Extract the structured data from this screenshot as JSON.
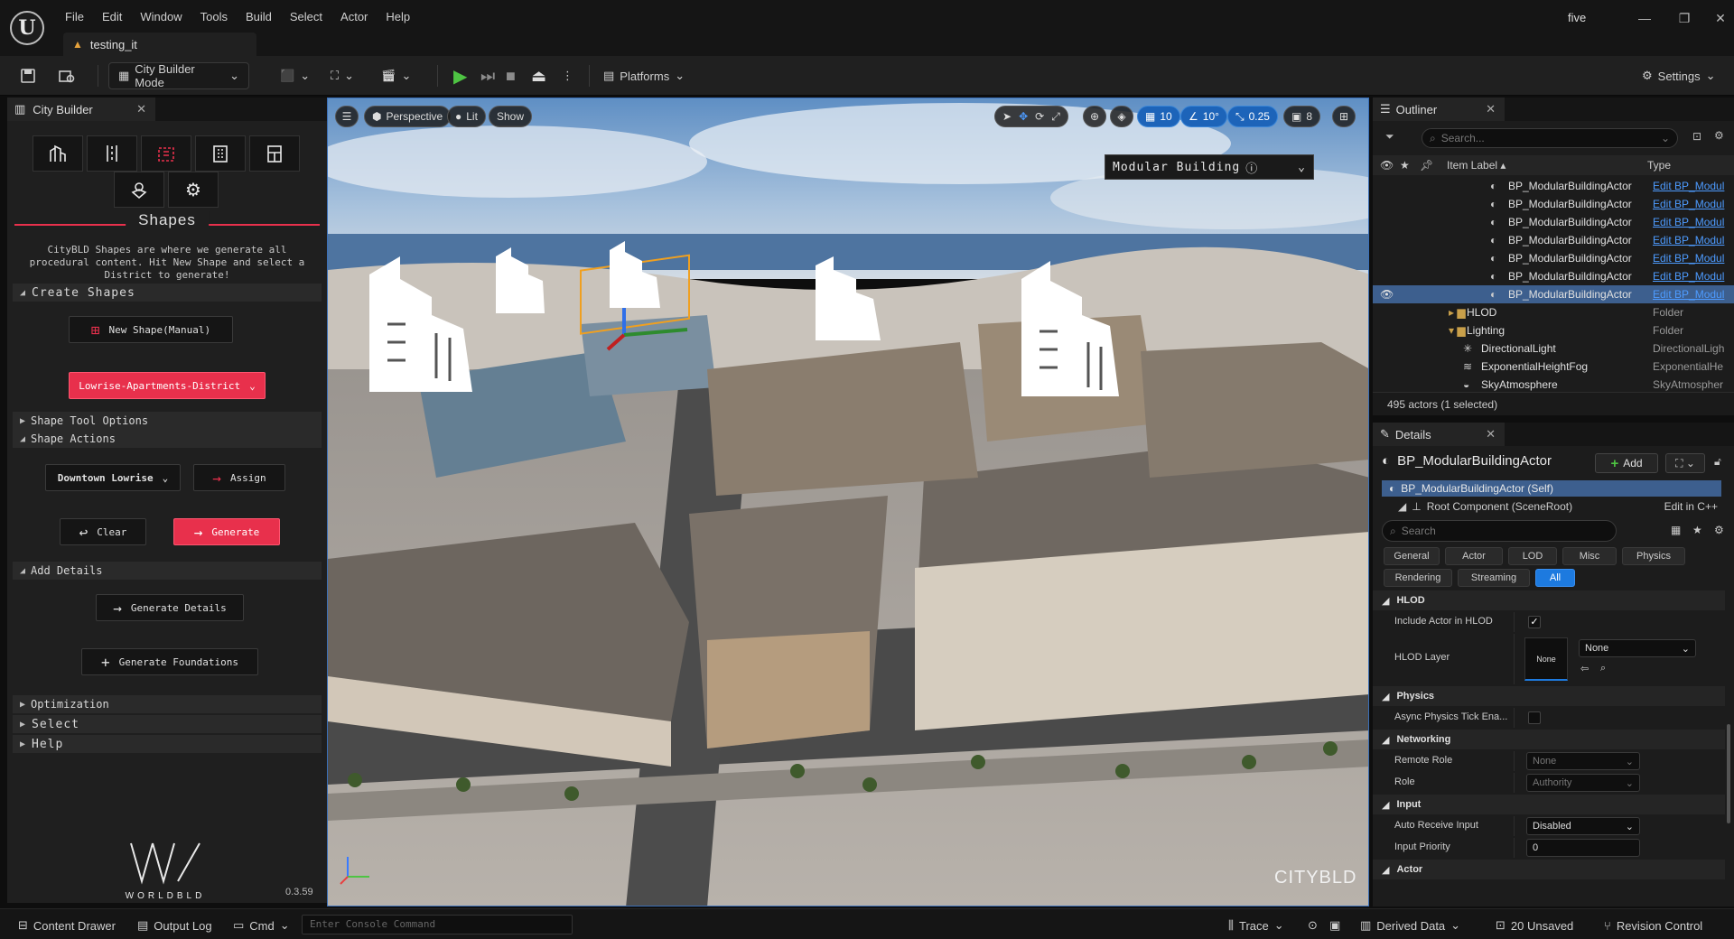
{
  "menu": [
    "File",
    "Edit",
    "Window",
    "Tools",
    "Build",
    "Select",
    "Actor",
    "Help"
  ],
  "project_tab": "testing_it",
  "user": "five",
  "toolbar": {
    "mode": "City Builder Mode",
    "platforms": "Platforms",
    "settings": "Settings"
  },
  "left_panel": {
    "tab": "City Builder",
    "icons": [
      "buildings-icon",
      "road-icon",
      "district-icon",
      "building-icon",
      "storefront-icon",
      "landmark-icon",
      "gear-icon"
    ],
    "shapes_title": "Shapes",
    "shapes_desc": "CityBLD Shapes are where we generate all procedural content. Hit New Shape and select a District to generate!",
    "create_shapes": "Create Shapes",
    "new_shape_button": "New Shape(Manual)",
    "district_dropdown": "Lowrise-Apartments-District",
    "shape_tool_options": "Shape Tool Options",
    "shape_actions": "Shape Actions",
    "downtown_dropdown": "Downtown Lowrise",
    "assign_button": "Assign",
    "clear_button": "Clear",
    "generate_button": "Generate",
    "add_details": "Add Details",
    "generate_details_button": "Generate Details",
    "generate_foundations_button": "Generate Foundations",
    "optimization": "Optimization",
    "select": "Select",
    "help": "Help",
    "brand": "WORLDBLD",
    "version": "0.3.59"
  },
  "viewport": {
    "perspective": "Perspective",
    "lit": "Lit",
    "show": "Show",
    "grid_snap": "10",
    "rot_snap": "10°",
    "scale_snap": "0.25",
    "cam_speed": "8",
    "dropdown": "Modular Building",
    "watermark": "CITYBLD"
  },
  "outliner": {
    "tab": "Outliner",
    "search_placeholder": "Search...",
    "col_label": "Item Label",
    "col_type": "Type",
    "rows": [
      {
        "label": "BP_ModularBuildingActor",
        "type": "Edit BP_Modul"
      },
      {
        "label": "BP_ModularBuildingActor",
        "type": "Edit BP_Modul"
      },
      {
        "label": "BP_ModularBuildingActor",
        "type": "Edit BP_Modul"
      },
      {
        "label": "BP_ModularBuildingActor",
        "type": "Edit BP_Modul"
      },
      {
        "label": "BP_ModularBuildingActor",
        "type": "Edit BP_Modul"
      },
      {
        "label": "BP_ModularBuildingActor",
        "type": "Edit BP_Modul"
      },
      {
        "label": "BP_ModularBuildingActor",
        "type": "Edit BP_Modul"
      },
      {
        "label": "HLOD",
        "type": "Folder"
      },
      {
        "label": "Lighting",
        "type": "Folder"
      },
      {
        "label": "DirectionalLight",
        "type": "DirectionalLigh"
      },
      {
        "label": "ExponentialHeightFog",
        "type": "ExponentialHe"
      },
      {
        "label": "SkyAtmosphere",
        "type": "SkyAtmospher"
      }
    ],
    "footer": "495 actors (1 selected)"
  },
  "details": {
    "tab": "Details",
    "title": "BP_ModularBuildingActor",
    "add": "Add",
    "self_row": "BP_ModularBuildingActor (Self)",
    "root_row": "Root Component (SceneRoot)",
    "root_edit": "Edit in C++",
    "search_placeholder": "Search",
    "filters": [
      "General",
      "Actor",
      "LOD",
      "Misc",
      "Physics",
      "Rendering",
      "Streaming",
      "All"
    ],
    "hlod": "HLOD",
    "include_hlod": "Include Actor in HLOD",
    "hlod_layer": "HLOD Layer",
    "hlod_thumb": "None",
    "hlod_combo": "None",
    "physics": "Physics",
    "async_physics": "Async Physics Tick Ena...",
    "networking": "Networking",
    "remote_role": "Remote Role",
    "remote_role_val": "None",
    "role": "Role",
    "role_val": "Authority",
    "input": "Input",
    "auto_receive": "Auto Receive Input",
    "auto_receive_val": "Disabled",
    "input_priority": "Input Priority",
    "input_priority_val": "0",
    "actor": "Actor"
  },
  "statusbar": {
    "content_drawer": "Content Drawer",
    "output_log": "Output Log",
    "cmd": "Cmd",
    "console_placeholder": "Enter Console Command",
    "trace": "Trace",
    "derived_data": "Derived Data",
    "unsaved": "20 Unsaved",
    "revision": "Revision Control"
  }
}
